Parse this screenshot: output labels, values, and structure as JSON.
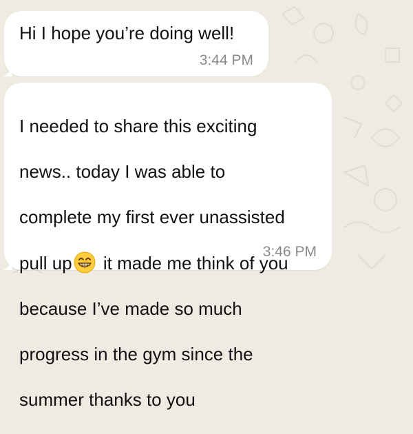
{
  "messages": [
    {
      "text": "Hi I hope you’re doing well!",
      "time": "3:44 PM"
    },
    {
      "line1": "I needed to share this exciting",
      "line2": "news.. today I was able to",
      "line3": "complete my first ever unassisted",
      "line4_before_emoji": "pull up",
      "line4_after_emoji": " it made me think of you",
      "line5": "because I’ve made so much",
      "line6": "progress in the gym since the",
      "line7": "summer thanks to you",
      "emoji_icon": "grinning-face-with-smiling-eyes-icon",
      "time": "3:46 PM"
    }
  ],
  "colors": {
    "wallpaper": "#efeae2",
    "bubble": "#ffffff",
    "text": "#111111",
    "timestamp": "#8a8a8a"
  }
}
